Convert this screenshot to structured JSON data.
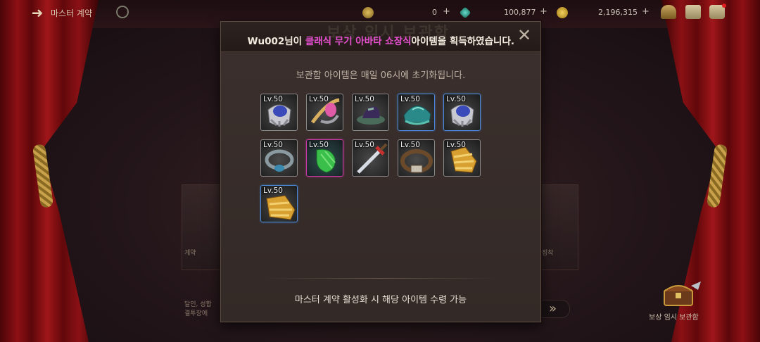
{
  "topbar": {
    "title": "마스터 계약",
    "currencies": [
      {
        "icon": "coin-icon",
        "value": "0",
        "color": "#c9a14a"
      },
      {
        "icon": "gem-icon",
        "value": "100,877",
        "color": "#3ab0a0"
      },
      {
        "icon": "gold-icon",
        "value": "2,196,315",
        "color": "#d8b040"
      }
    ],
    "icons": [
      "hat-icon",
      "mail-icon",
      "chat-icon"
    ]
  },
  "dialog": {
    "ghost_title": "보상 임시 보관함",
    "notice_prefix": "Wu002님이 ",
    "notice_highlight": "클래식 무기 아바타 쇼장식",
    "notice_suffix": "아이템을 획득하였습니다.",
    "reset_text": "보관함 아이템은 매일 06시에 초기화됩니다.",
    "claim_text": "마스터 계약 활성화 시 해당 아이템 수령 가능",
    "items": [
      {
        "level": "Lv.50",
        "grade": "grey",
        "icon": "shoulder-armor-icon"
      },
      {
        "level": "Lv.50",
        "grade": "grey",
        "icon": "whistle-icon"
      },
      {
        "level": "Lv.50",
        "grade": "grey",
        "icon": "hat-icon"
      },
      {
        "level": "Lv.50",
        "grade": "blue",
        "icon": "helmet-icon"
      },
      {
        "level": "Lv.50",
        "grade": "blue",
        "icon": "shoulder-armor-icon"
      },
      {
        "level": "Lv.50",
        "grade": "grey",
        "icon": "ring-icon"
      },
      {
        "level": "Lv.50",
        "grade": "pink",
        "icon": "glove-icon"
      },
      {
        "level": "Lv.50",
        "grade": "grey",
        "icon": "sword-icon"
      },
      {
        "level": "Lv.50",
        "grade": "grey",
        "icon": "belt-icon"
      },
      {
        "level": "Lv.50",
        "grade": "grey",
        "icon": "gold-boots-icon"
      },
      {
        "level": "Lv.50",
        "grade": "blue",
        "icon": "gold-boots-icon"
      }
    ]
  },
  "background": {
    "left_text": "달인, 성합\n결투장에",
    "left_card_text": "계약",
    "right_card_text": "정착",
    "treasure_label": "보상 임시 보관함"
  }
}
